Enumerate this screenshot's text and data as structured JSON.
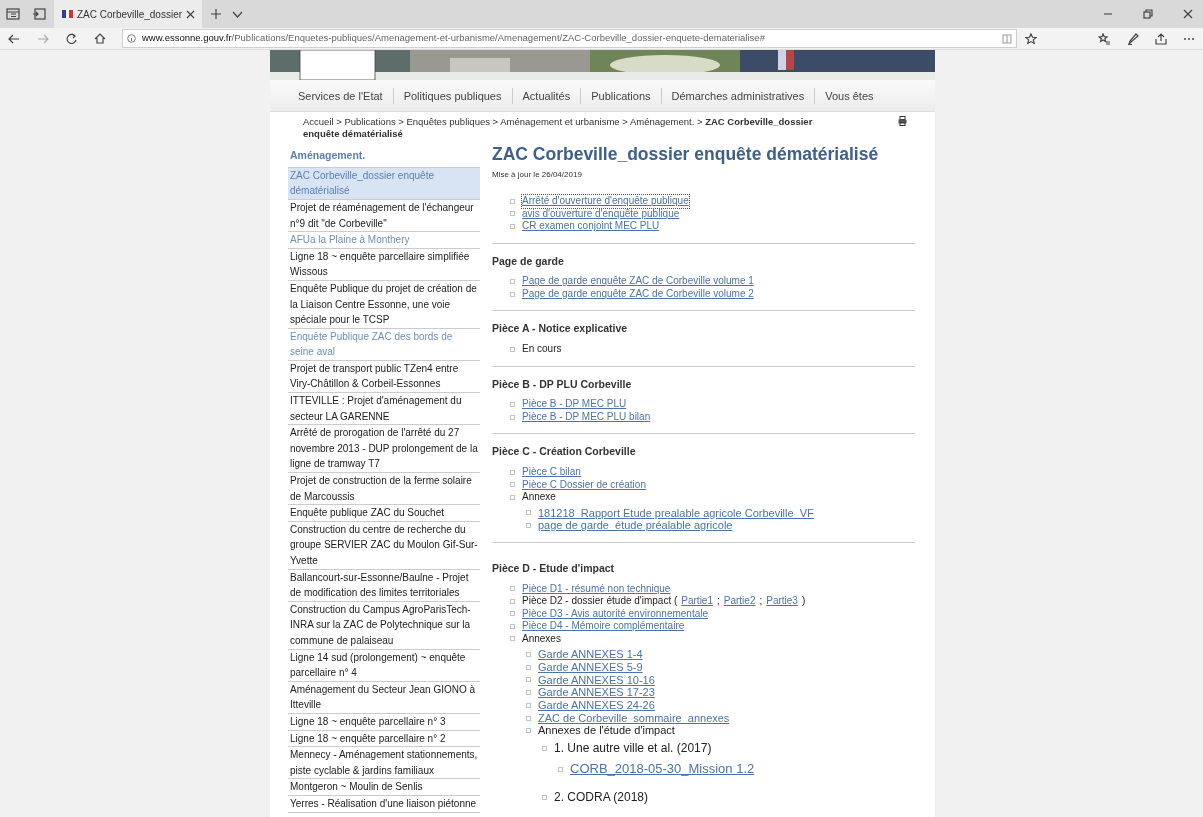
{
  "browser": {
    "tab_title": "ZAC Corbeville_dossier",
    "url_host": "www.essonne.gouv.fr",
    "url_path": "/Publications/Enquetes-publiques/Amenagement-et-urbanisme/Amenagement/ZAC-Corbeville_dossier-enquete-dematerialise#"
  },
  "nav": [
    "Services de l'Etat",
    "Politiques publiques",
    "Actualités",
    "Publications",
    "Démarches administratives",
    "Vous êtes"
  ],
  "breadcrumb": "Accueil > Publications > Enquêtes publiques > Aménagement et urbanisme > Aménagement. > **ZAC Corbeville_dossier enquête dématérialisé**",
  "sidebar": {
    "title": "Aménagement.",
    "items": [
      {
        "label": "ZAC Corbeville_dossier enquête dématérialisé",
        "selected": true,
        "visited": false
      },
      {
        "label": "Projet de réaménagement de l'échangeur n°9 dit \"de Corbeville\"",
        "selected": false,
        "visited": false
      },
      {
        "label": "AFUa la Plaine à Monthery",
        "selected": false,
        "visited": true
      },
      {
        "label": "Ligne 18 ~ enquête parcellaire simplifiée Wissous",
        "selected": false,
        "visited": false
      },
      {
        "label": "Enquête Publique du projet de création de la Liaison Centre Essonne, une voie spéciale pour le TCSP",
        "selected": false,
        "visited": false
      },
      {
        "label": "Enquête Publique ZAC des bords de seine aval",
        "selected": false,
        "visited": true
      },
      {
        "label": "Projet de transport public TZen4 entre Viry-Châtillon & Corbeil-Essonnes",
        "selected": false,
        "visited": false
      },
      {
        "label": "ITTEVILLE : Projet d'aménagement du secteur LA GARENNE",
        "selected": false,
        "visited": false
      },
      {
        "label": "Arrêté de prorogation de l'arrêté du 27 novembre 2013 - DUP prolongement de la ligne de tramway T7",
        "selected": false,
        "visited": false
      },
      {
        "label": "Projet de construction de la ferme solaire de Marcoussis",
        "selected": false,
        "visited": false
      },
      {
        "label": "Enquête publique ZAC du Souchet",
        "selected": false,
        "visited": false
      },
      {
        "label": "Construction du centre de recherche du groupe SERVIER ZAC du Moulon Gif-Sur-Yvette",
        "selected": false,
        "visited": false
      },
      {
        "label": "Ballancourt-sur-Essonne/Baulne - Projet de modification des limites territoriales",
        "selected": false,
        "visited": false
      },
      {
        "label": "Construction du Campus AgroParisTech-INRA sur la ZAC de Polytechnique sur la commune de palaiseau",
        "selected": false,
        "visited": false
      },
      {
        "label": "Ligne 14 sud (prolongement) ~ enquête parcellaire n° 4",
        "selected": false,
        "visited": false
      },
      {
        "label": "Aménagement du Secteur Jean GIONO à Itteville",
        "selected": false,
        "visited": false
      },
      {
        "label": "Ligne 18 ~ enquête parcellaire n° 3",
        "selected": false,
        "visited": false
      },
      {
        "label": "Ligne 18 ~ enquête parcellaire n° 2",
        "selected": false,
        "visited": false
      },
      {
        "label": "Mennecy - Aménagement stationnements, piste cyclable & jardins familiaux",
        "selected": false,
        "visited": false
      },
      {
        "label": "Montgeron ~ Moulin de Senlis",
        "selected": false,
        "visited": false
      },
      {
        "label": "Yerres - Réalisation d'une liaison piétonne",
        "selected": false,
        "visited": false
      }
    ]
  },
  "content": {
    "title": "ZAC Corbeville_dossier enquête dématérialisé",
    "updated": "Mise à jour le 26/04/2019",
    "sections": [
      {
        "items": [
          {
            "kind": "link",
            "text": "Arrêté d'ouverture d'enquête publique",
            "focused": true
          },
          {
            "kind": "link",
            "text": "avis d'ouverture d'enquête publique",
            "focused": false
          },
          {
            "kind": "link",
            "text": "CR examen conjoint MEC PLU",
            "focused": false
          }
        ]
      },
      {
        "heading": "Page de garde",
        "items": [
          {
            "kind": "link",
            "text": "Page de garde  enquête  ZAC de Corbeville  volume 1",
            "focused": false
          },
          {
            "kind": "link",
            "text": "Page de garde  enquête  ZAC de Corbeville  volume 2",
            "focused": false
          }
        ]
      },
      {
        "heading": "Pièce A - Notice explicative",
        "items": [
          {
            "kind": "text",
            "text": "En cours"
          }
        ]
      },
      {
        "heading": "Pièce B - DP PLU Corbeville",
        "items": [
          {
            "kind": "link",
            "text": "Pièce B - DP MEC PLU",
            "focused": false
          },
          {
            "kind": "link",
            "text": "Pièce B - DP MEC PLU  bilan",
            "focused": false
          }
        ]
      },
      {
        "heading": "Pièce C - Création Corbeville",
        "items": [
          {
            "kind": "link",
            "text": "Pièce C  bilan",
            "focused": false
          },
          {
            "kind": "link",
            "text": "Pièce C  Dossier de création",
            "focused": false
          },
          {
            "kind": "text",
            "text": "Annexe",
            "children": [
              {
                "kind": "link",
                "text": "181218_Rapport Etude prealable agricole Corbeville_VF",
                "focused": false
              },
              {
                "kind": "link",
                "text": "page de garde_étude préalable agricole",
                "focused": false
              }
            ]
          }
        ]
      },
      {
        "heading": "Pièce D -  Etude d'impact",
        "items": [
          {
            "kind": "link",
            "text": "Pièce D1 - résumé non technique",
            "focused": false
          },
          {
            "kind": "mixed",
            "parts": [
              {
                "kind": "text",
                "text": "Pièce D2 - dossier étude d'impact ("
              },
              {
                "kind": "link",
                "text": "Partie1"
              },
              {
                "kind": "text",
                "text": ";"
              },
              {
                "kind": "link",
                "text": "Partie2"
              },
              {
                "kind": "text",
                "text": ";"
              },
              {
                "kind": "link",
                "text": "Partie3"
              },
              {
                "kind": "text",
                "text": ")"
              }
            ]
          },
          {
            "kind": "link",
            "text": "Pièce D3 - Avis autorité environnementale",
            "focused": false
          },
          {
            "kind": "link",
            "text": "Pièce D4 - Mémoire complémentaire",
            "focused": false
          },
          {
            "kind": "text",
            "text": "Annexes",
            "children": [
              {
                "kind": "link",
                "text": "Garde ANNEXES 1-4",
                "focused": false
              },
              {
                "kind": "link",
                "text": "Garde ANNEXES 5-9",
                "focused": false
              },
              {
                "kind": "link",
                "text": "Garde ANNEXES 10-16",
                "focused": false
              },
              {
                "kind": "link",
                "text": "Garde ANNEXES 17-23",
                "focused": false
              },
              {
                "kind": "link",
                "text": "Garde ANNEXES 24-26",
                "focused": false
              },
              {
                "kind": "link",
                "text": "ZAC de Corbeville_sommaire_annexes",
                "focused": false
              },
              {
                "kind": "text",
                "text": "Annexes de l'étude d'impact",
                "children": [
                  {
                    "kind": "text",
                    "text": "1. Une autre ville et al. (2017)",
                    "children": [
                      {
                        "kind": "link",
                        "text": "CORB_2018-05-30_Mission 1.2",
                        "focused": false
                      }
                    ]
                  },
                  {
                    "kind": "text",
                    "text": "2. CODRA (2018)"
                  }
                ]
              }
            ]
          }
        ]
      }
    ]
  }
}
